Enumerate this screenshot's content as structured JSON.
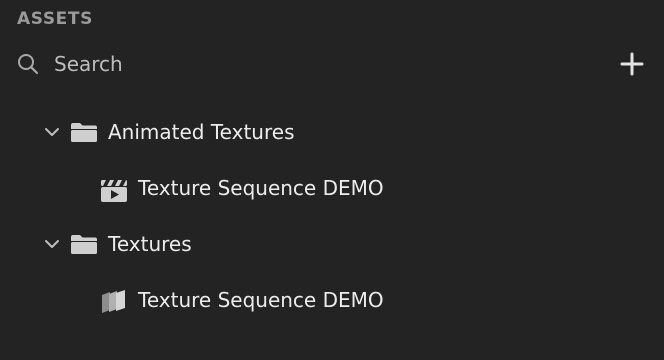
{
  "panel": {
    "title": "ASSETS"
  },
  "search": {
    "placeholder": "Search",
    "icon": "search-icon",
    "add_icon": "plus-icon"
  },
  "tree": [
    {
      "label": "Animated Textures",
      "type": "folder",
      "expanded": true,
      "icon": "folder-icon"
    },
    {
      "label": "Texture Sequence DEMO",
      "type": "animated-texture",
      "icon": "clapperboard-play-icon"
    },
    {
      "label": "Textures",
      "type": "folder",
      "expanded": true,
      "icon": "folder-icon"
    },
    {
      "label": "Texture Sequence DEMO",
      "type": "texture-sequence",
      "icon": "stacked-layers-icon"
    }
  ],
  "colors": {
    "background": "#232323",
    "title": "#9a9a9a",
    "text": "#ececec",
    "icon": "#c8c8c8"
  }
}
